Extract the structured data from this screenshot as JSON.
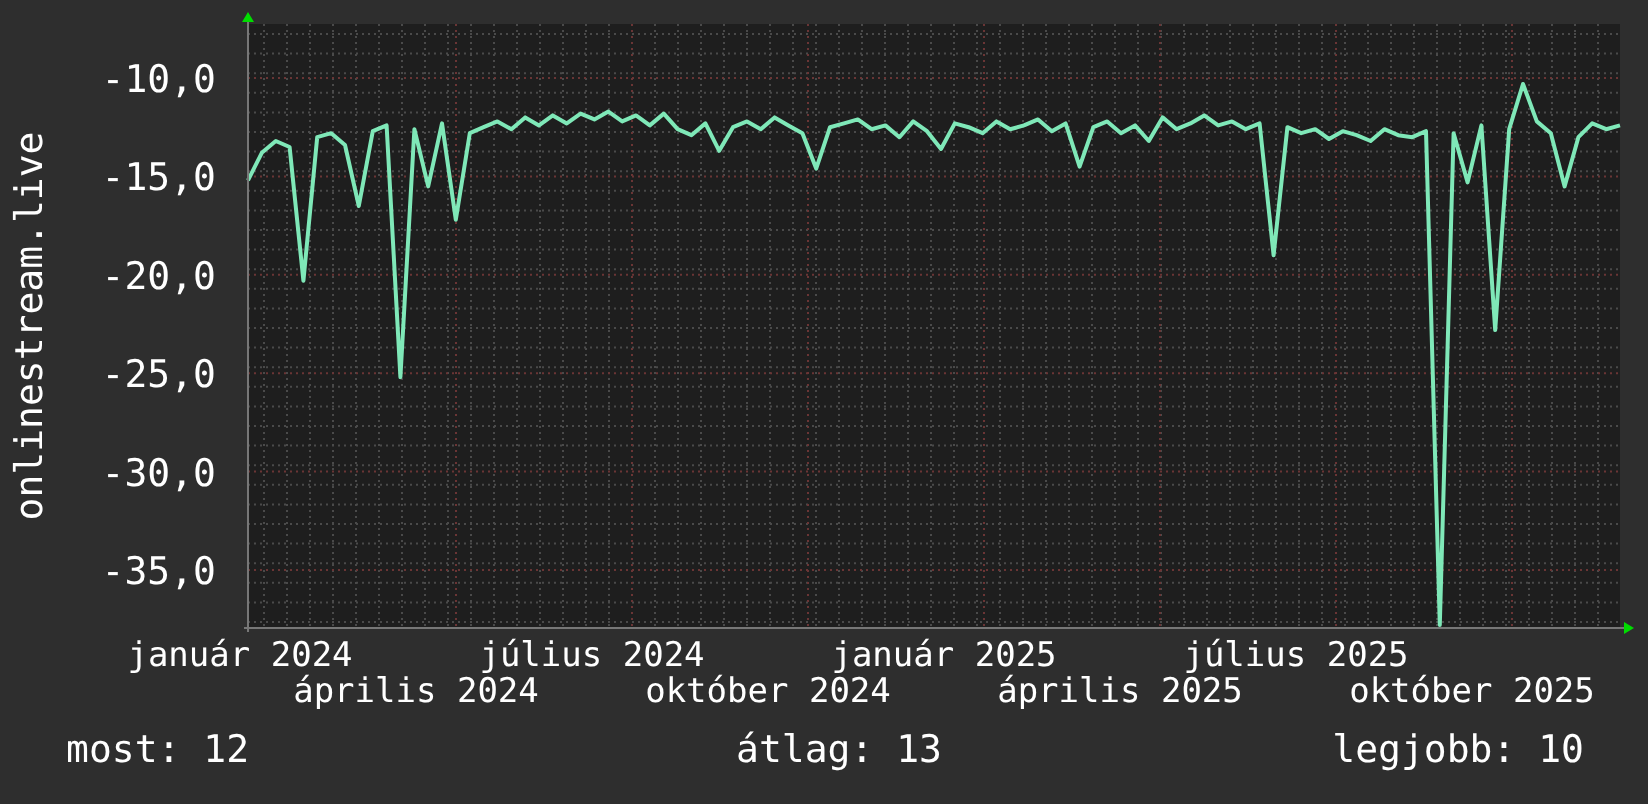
{
  "chart": {
    "x_labels": [
      "január 2024",
      "április 2024",
      "július 2024",
      "október 2024",
      "január 2025",
      "április 2025",
      "július 2025",
      "október 2025"
    ],
    "chart_data": {
      "type": "line",
      "grid": true,
      "series": [
        {
          "name": "onlinestream.live",
          "color": "#7fe8b8",
          "values": [
            -15.2,
            -13.8,
            -13.2,
            -13.5,
            -20.3,
            -13.0,
            -12.8,
            -13.4,
            -16.5,
            -12.7,
            -12.4,
            -25.2,
            -12.6,
            -15.5,
            -12.3,
            -17.2,
            -12.8,
            -12.5,
            -12.2,
            -12.6,
            -12.0,
            -12.4,
            -11.9,
            -12.3,
            -11.8,
            -12.1,
            -11.7,
            -12.2,
            -11.9,
            -12.4,
            -11.8,
            -12.6,
            -12.9,
            -12.3,
            -13.7,
            -12.5,
            -12.2,
            -12.6,
            -12.0,
            -12.4,
            -12.8,
            -14.6,
            -12.5,
            -12.3,
            -12.1,
            -12.6,
            -12.4,
            -13.0,
            -12.2,
            -12.7,
            -13.6,
            -12.3,
            -12.5,
            -12.8,
            -12.2,
            -12.6,
            -12.4,
            -12.1,
            -12.7,
            -12.3,
            -14.5,
            -12.5,
            -12.2,
            -12.8,
            -12.4,
            -13.2,
            -12.0,
            -12.6,
            -12.3,
            -11.9,
            -12.4,
            -12.2,
            -12.6,
            -12.3,
            -19.0,
            -12.5,
            -12.8,
            -12.6,
            -13.1,
            -12.7,
            -12.9,
            -13.2,
            -12.6,
            -12.9,
            -13.0,
            -12.7,
            -37.8,
            -12.8,
            -15.3,
            -12.4,
            -22.8,
            -12.6,
            -10.3,
            -12.2,
            -12.8,
            -15.5,
            -13.0,
            -12.3,
            -12.6,
            -12.4
          ]
        }
      ],
      "ylim": [
        -37.95,
        -7.25
      ],
      "yticks": [
        {
          "value": -10,
          "label": "-10,0"
        },
        {
          "value": -15,
          "label": "-15,0"
        },
        {
          "value": -20,
          "label": "-20,0"
        },
        {
          "value": -25,
          "label": "-25,0"
        },
        {
          "value": -30,
          "label": "-30,0"
        },
        {
          "value": -35,
          "label": "-35,0"
        }
      ]
    }
  },
  "legend": [
    {
      "label": "most:",
      "value": "12"
    },
    {
      "label": "átlag:",
      "value": "13"
    },
    {
      "label": "legjobb:",
      "value": "10"
    }
  ]
}
